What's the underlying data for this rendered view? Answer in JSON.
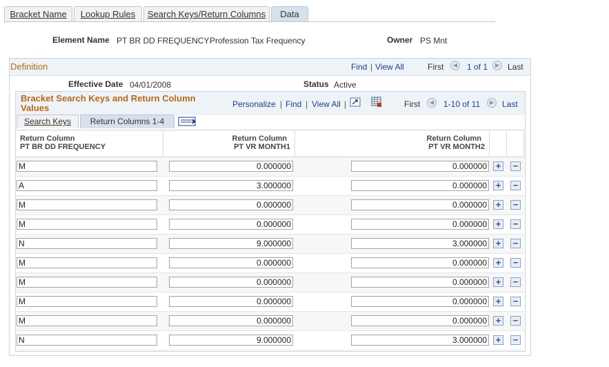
{
  "tabs": [
    {
      "label": "Bracket Name",
      "active": false
    },
    {
      "label": "Lookup Rules",
      "active": false
    },
    {
      "label": "Search Keys/Return Columns",
      "active": false
    },
    {
      "label": "Data",
      "active": true
    }
  ],
  "header": {
    "element_name_label": "Element Name",
    "element_name_value": "PT BR DD FREQUENCY",
    "element_desc": "Profession Tax Frequency",
    "owner_label": "Owner",
    "owner_value": "PS Mnt"
  },
  "definition": {
    "title": "Definition",
    "find": "Find",
    "view_all": "View All",
    "first": "First",
    "range": "1 of 1",
    "last": "Last",
    "effective_date_label": "Effective Date",
    "effective_date_value": "04/01/2008",
    "status_label": "Status",
    "status_value": "Active"
  },
  "grid": {
    "title_line1": "Bracket Search Keys and Return Column",
    "title_line2": "Values",
    "personalize": "Personalize",
    "find": "Find",
    "view_all": "View All",
    "first": "First",
    "range": "1-10 of 11",
    "last": "Last",
    "subtabs": [
      {
        "label": "Search Keys",
        "active": false
      },
      {
        "label": "Return Columns 1-4",
        "active": true
      }
    ],
    "columns": [
      {
        "line1": "Return Column",
        "line2": "PT BR DD FREQUENCY"
      },
      {
        "line1": "Return Column",
        "line2": "PT VR MONTH1"
      },
      {
        "line1": "Return Column",
        "line2": "PT VR MONTH2"
      }
    ],
    "rows": [
      {
        "key": "M",
        "month1": "0.000000",
        "month2": "0.000000"
      },
      {
        "key": "A",
        "month1": "3.000000",
        "month2": "0.000000"
      },
      {
        "key": "M",
        "month1": "0.000000",
        "month2": "0.000000"
      },
      {
        "key": "M",
        "month1": "0.000000",
        "month2": "0.000000"
      },
      {
        "key": "N",
        "month1": "9.000000",
        "month2": "3.000000"
      },
      {
        "key": "M",
        "month1": "0.000000",
        "month2": "0.000000"
      },
      {
        "key": "M",
        "month1": "0.000000",
        "month2": "0.000000"
      },
      {
        "key": "M",
        "month1": "0.000000",
        "month2": "0.000000"
      },
      {
        "key": "M",
        "month1": "0.000000",
        "month2": "0.000000"
      },
      {
        "key": "N",
        "month1": "9.000000",
        "month2": "3.000000"
      }
    ],
    "add_symbol": "+",
    "remove_symbol": "−"
  },
  "icons": {
    "prev": "◀",
    "next": "▶"
  },
  "colors": {
    "link": "#1f3e80",
    "section_title": "#b46a17",
    "active_tab": "#d6e1ec"
  }
}
